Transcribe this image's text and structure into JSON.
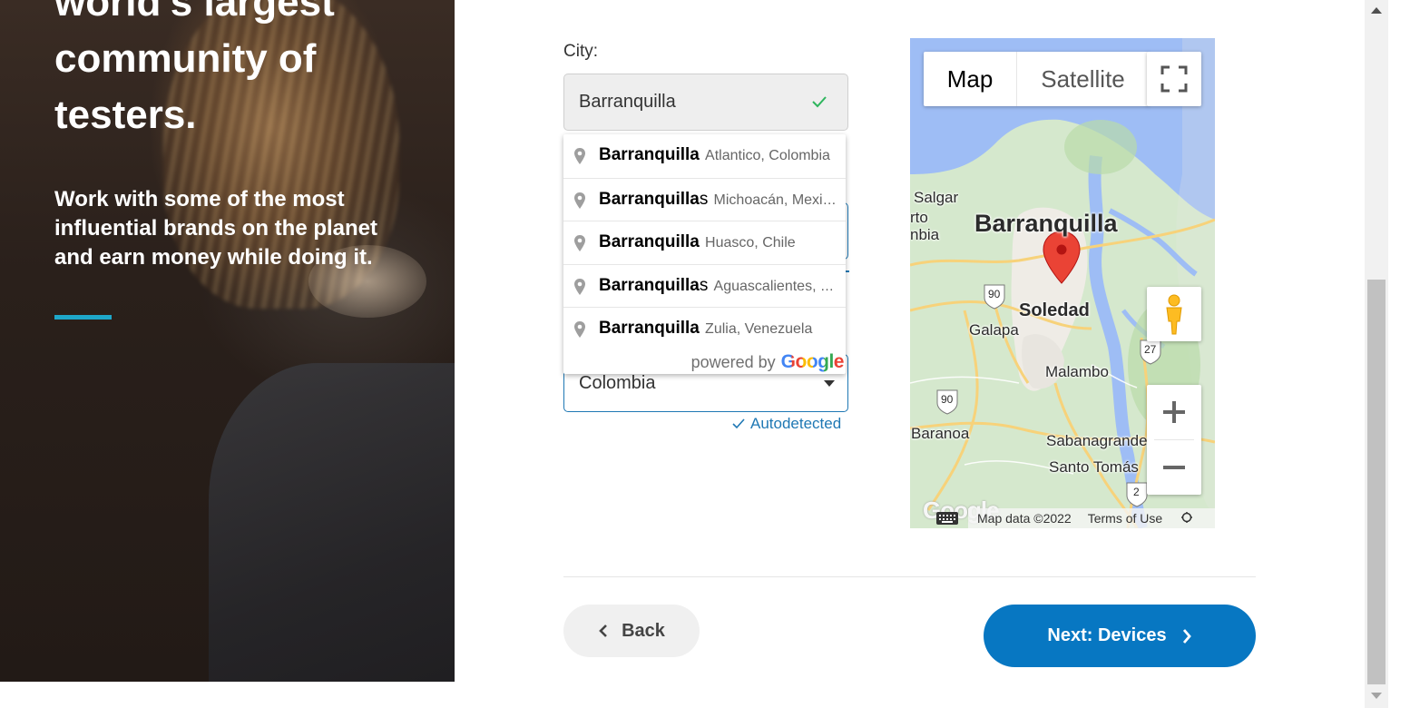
{
  "hero": {
    "title": "world's largest\ncommunity of\ntesters.",
    "subtitle": "Work with some of the most influential brands on the planet and earn money while doing it."
  },
  "city": {
    "label": "City:",
    "value": "Barranquilla"
  },
  "autocomplete": {
    "items": [
      {
        "main": "Barranquilla",
        "match": "Barranquilla",
        "rest": "",
        "secondary": "Atlantico, Colombia"
      },
      {
        "main": "Barranquillas",
        "match": "Barranquilla",
        "rest": "s",
        "secondary": "Michoacán, Mexico"
      },
      {
        "main": "Barranquilla",
        "match": "Barranquilla",
        "rest": "",
        "secondary": "Huasco, Chile"
      },
      {
        "main": "Barranquillas",
        "match": "Barranquilla",
        "rest": "s",
        "secondary": "Aguascalientes, Mexico"
      },
      {
        "main": "Barranquilla",
        "match": "Barranquilla",
        "rest": "",
        "secondary": "Zulia, Venezuela"
      }
    ],
    "footer_prefix": "powered by",
    "footer_brand": "Google"
  },
  "country": {
    "value": "Colombia",
    "autodetected": "Autodetected"
  },
  "map": {
    "type_map": "Map",
    "type_satellite": "Satellite",
    "labels": {
      "barranquilla": "Barranquilla",
      "soledad": "Soledad",
      "galapa": "Galapa",
      "malambo": "Malambo",
      "baranoa": "Baranoa",
      "sabanagrande": "Sabanagrande",
      "santo_tomas": "Santo Tomás",
      "salgar": "Salgar",
      "puerto": "rto",
      "colombia": "nbia",
      "route_90a": "90",
      "route_90b": "90",
      "route_27": "27",
      "route_2": "2"
    },
    "logo": "Google",
    "map_data": "Map data ©2022",
    "terms": "Terms of Use"
  },
  "buttons": {
    "back": "Back",
    "next": "Next: Devices"
  },
  "colors": {
    "accent": "#0777c2",
    "hero_bar": "#1ea7c9",
    "check": "#2eb55d"
  }
}
